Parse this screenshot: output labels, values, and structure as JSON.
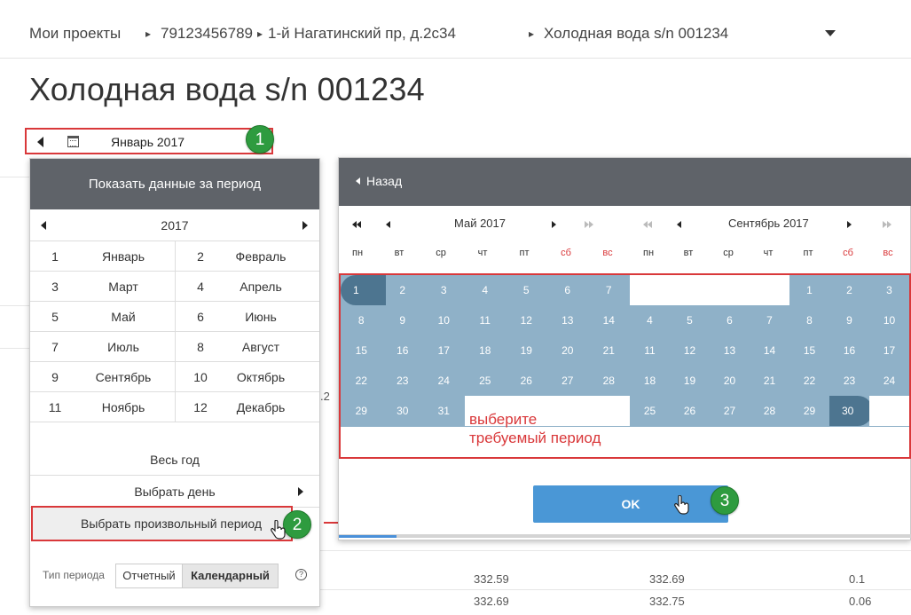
{
  "breadcrumb": {
    "items": [
      "Мои проекты",
      "79123456789",
      "1-й Нагатинский пр, д.2с34",
      "Холодная вода s/n 001234"
    ],
    "separator": "▸"
  },
  "page": {
    "title": "Холодная вода s/n 001234"
  },
  "period_bar": {
    "label": "Январь 2017",
    "badge": "1"
  },
  "dropdown": {
    "header": "Показать данные за период",
    "year": "2017",
    "months": [
      {
        "n": "1",
        "name": "Январь"
      },
      {
        "n": "2",
        "name": "Февраль"
      },
      {
        "n": "3",
        "name": "Март"
      },
      {
        "n": "4",
        "name": "Апрель"
      },
      {
        "n": "5",
        "name": "Май"
      },
      {
        "n": "6",
        "name": "Июнь"
      },
      {
        "n": "7",
        "name": "Июль"
      },
      {
        "n": "8",
        "name": "Август"
      },
      {
        "n": "9",
        "name": "Сентябрь"
      },
      {
        "n": "10",
        "name": "Октябрь"
      },
      {
        "n": "11",
        "name": "Ноябрь"
      },
      {
        "n": "12",
        "name": "Декабрь"
      }
    ],
    "whole_year": "Весь год",
    "choose_day": "Выбрать день",
    "custom_period": "Выбрать произвольный период",
    "badge": "2",
    "period_type_label": "Тип периода",
    "period_type_options": [
      "Отчетный",
      "Календарный"
    ],
    "period_type_selected": "Календарный",
    "help": "?"
  },
  "calendar": {
    "back": "Назад",
    "left_month": "Май 2017",
    "right_month": "Сентябрь 2017",
    "weekdays": [
      "пн",
      "вт",
      "ср",
      "чт",
      "пт",
      "сб",
      "вс"
    ],
    "left_weeks": [
      [
        "1",
        "2",
        "3",
        "4",
        "5",
        "6",
        "7"
      ],
      [
        "8",
        "9",
        "10",
        "11",
        "12",
        "13",
        "14"
      ],
      [
        "15",
        "16",
        "17",
        "18",
        "19",
        "20",
        "21"
      ],
      [
        "22",
        "23",
        "24",
        "25",
        "26",
        "27",
        "28"
      ],
      [
        "29",
        "30",
        "31",
        "",
        "",
        "",
        ""
      ]
    ],
    "right_weeks": [
      [
        "",
        "",
        "",
        "",
        "1",
        "2",
        "3"
      ],
      [
        "4",
        "5",
        "6",
        "7",
        "8",
        "9",
        "10"
      ],
      [
        "11",
        "12",
        "13",
        "14",
        "15",
        "16",
        "17"
      ],
      [
        "18",
        "19",
        "20",
        "21",
        "22",
        "23",
        "24"
      ],
      [
        "25",
        "26",
        "27",
        "28",
        "29",
        "30",
        ""
      ]
    ],
    "annotation": [
      "выберите",
      "требуемый период"
    ],
    "ok": "OK",
    "badge": "3"
  },
  "background_table": {
    "rows": [
      [
        "332.59",
        "332.69",
        "0.1"
      ],
      [
        "332.69",
        "332.75",
        "0.06"
      ]
    ],
    "fragment": ".2"
  },
  "colors": {
    "header_bg": "#5f6369",
    "range_fill": "#8fb1c8",
    "range_endpoint": "#4d7590",
    "highlight_red": "#d9383a",
    "badge_green": "#2e9b3f",
    "ok_blue": "#4a97d6"
  }
}
